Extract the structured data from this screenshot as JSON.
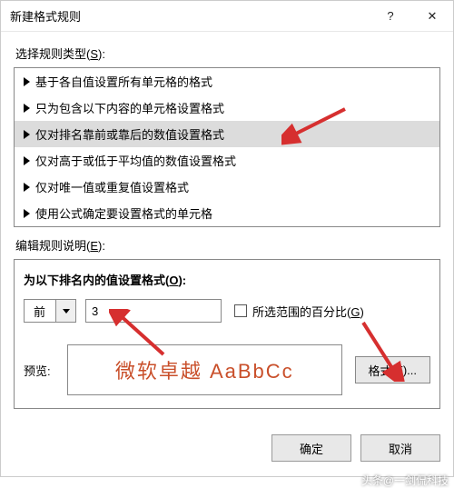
{
  "window": {
    "title": "新建格式规则"
  },
  "labels": {
    "selectRuleType": "选择规则类型(",
    "selectRuleTypeKey": "S",
    "selectRuleTypeEnd": "):",
    "editRuleDesc": "编辑规则说明(",
    "editRuleDescKey": "E",
    "editRuleDescEnd": "):",
    "groupTitle": "为以下排名内的值设置格式(",
    "groupTitleKey": "O",
    "groupTitleEnd": "):",
    "percentOfRange": "所选范围的百分比(",
    "percentKey": "G",
    "percentEnd": ")",
    "previewLabel": "预览:",
    "formatBtn": "格式(",
    "formatKey": "F",
    "formatEnd": ")...",
    "ok": "确定",
    "cancel": "取消"
  },
  "ruleTypes": [
    "基于各自值设置所有单元格的格式",
    "只为包含以下内容的单元格设置格式",
    "仅对排名靠前或靠后的数值设置格式",
    "仅对高于或低于平均值的数值设置格式",
    "仅对唯一值或重复值设置格式",
    "使用公式确定要设置格式的单元格"
  ],
  "selectedRuleIndex": 2,
  "topBottom": {
    "direction": "前",
    "count": "3"
  },
  "preview": {
    "sample": "微软卓越   AaBbCc",
    "color": "#c94f2a"
  },
  "watermark": "头条@一剑侃科技"
}
